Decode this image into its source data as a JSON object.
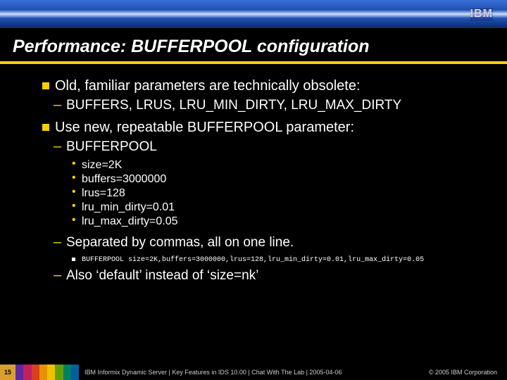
{
  "header": {
    "logo": "IBM"
  },
  "title": "Performance: BUFFERPOOL configuration",
  "content": {
    "b1a": "Old, familiar parameters are technically obsolete:",
    "b1a_sub": "BUFFERS, LRUS, LRU_MIN_DIRTY, LRU_MAX_DIRTY",
    "b1b": "Use new, repeatable BUFFERPOOL parameter:",
    "b1b_sub1": "BUFFERPOOL",
    "params": [
      "size=2K",
      "buffers=3000000",
      "lrus=128",
      "lru_min_dirty=0.01",
      "lru_max_dirty=0.05"
    ],
    "b1b_sub2": "Separated by commas, all on one line.",
    "example_label": "BUFFERPOOL size=2K,buffers=3000000,lrus=128,lru_min_dirty=0.01,lru_max_dirty=0.05",
    "b1b_sub3": "Also ‘default’ instead of ‘size=nk’"
  },
  "footer": {
    "page": "15",
    "strip_colors": [
      "#5a2aa0",
      "#c02060",
      "#d84020",
      "#e89000",
      "#f0c000",
      "#66a000",
      "#008060",
      "#0060a0"
    ],
    "text": "IBM Informix Dynamic Server | Key Features in IDS 10.00 | Chat With The Lab | 2005-04-06",
    "copyright": "© 2005 IBM Corporation"
  }
}
